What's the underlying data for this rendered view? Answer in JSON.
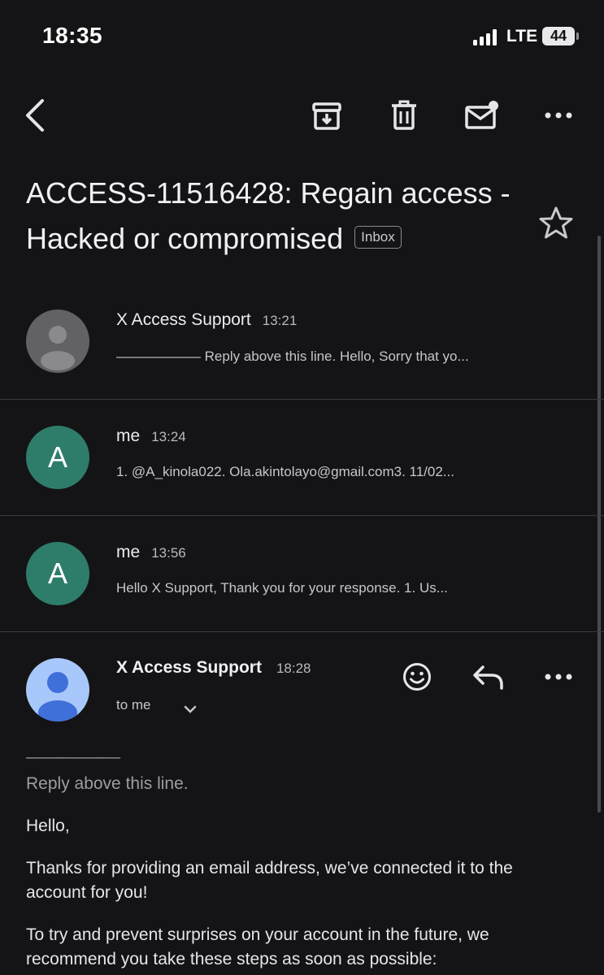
{
  "status_bar": {
    "time": "18:35",
    "network": "LTE",
    "battery": "44"
  },
  "subject": {
    "title": "ACCESS-11516428: Regain access - Hacked or compromised",
    "label": "Inbox"
  },
  "threads": [
    {
      "sender": "X Access Support",
      "time": "13:21",
      "snippet": "——–——–— Reply above this line. Hello, Sorry that yo...",
      "avatar": "person-placeholder"
    },
    {
      "sender": "me",
      "time": "13:24",
      "snippet": "1. @A_kinola022. Ola.akintolayo@gmail.com3. 11/02...",
      "avatar_letter": "A"
    },
    {
      "sender": "me",
      "time": "13:56",
      "snippet": "Hello X Support, Thank you for your response. 1. Us...",
      "avatar_letter": "A"
    }
  ],
  "open_message": {
    "sender": "X Access Support",
    "time": "18:28",
    "recipient": "to me",
    "separator": "——–——–—",
    "reply_line": "Reply above this line.",
    "greeting": "Hello,",
    "paragraph1": "Thanks for providing an email address, we’ve connected it to the account for you!",
    "paragraph2": "To try and prevent surprises on your account in the future, we recommend you take these steps as soon as possible:"
  },
  "colors": {
    "background": "#141416",
    "avatar_green": "#2e7d6b",
    "avatar_blue": "#a8c7fa"
  }
}
